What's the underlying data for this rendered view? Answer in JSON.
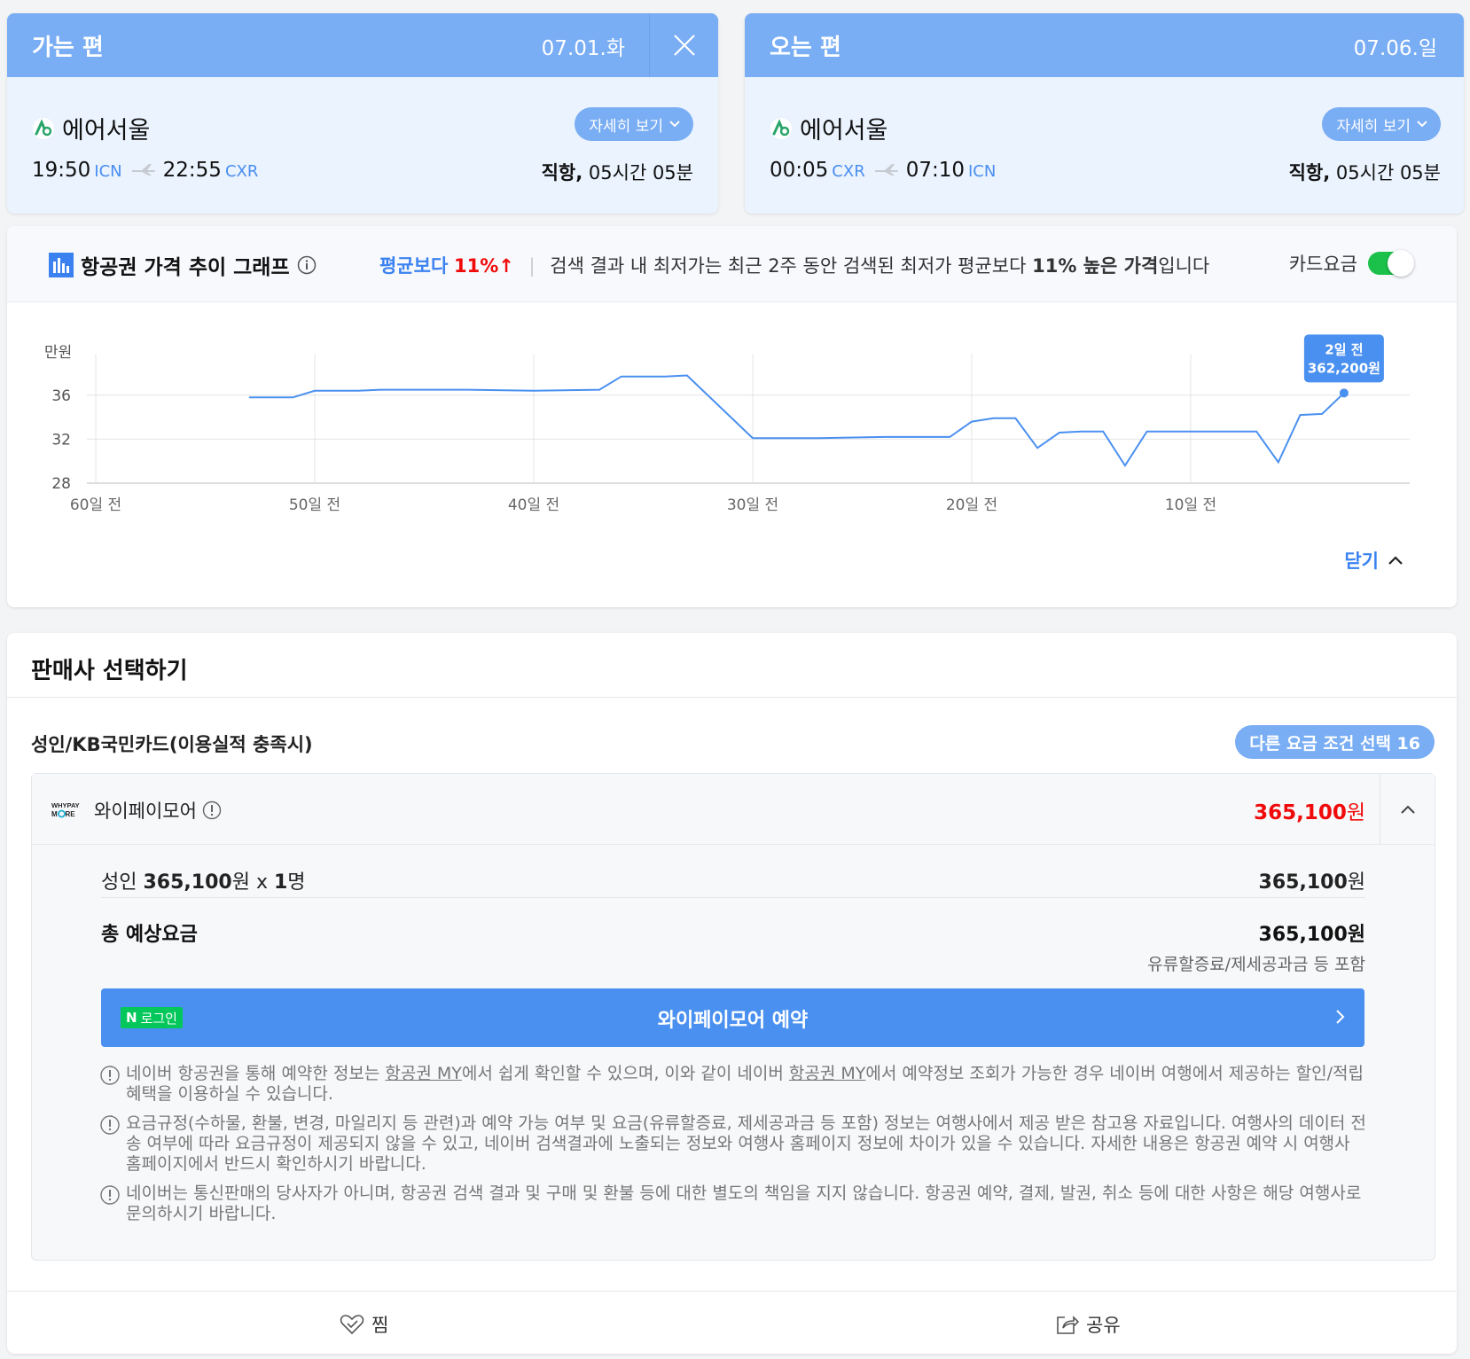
{
  "outbound": {
    "title": "가는 편",
    "date": "07.01.화",
    "airline": "에어서울",
    "detail_label": "자세히 보기",
    "depart_time": "19:50",
    "depart_code": "ICN",
    "arrive_time": "22:55",
    "arrive_code": "CXR",
    "duration_type": "직항,",
    "duration": "05시간 05분"
  },
  "inbound": {
    "title": "오는 편",
    "date": "07.06.일",
    "airline": "에어서울",
    "detail_label": "자세히 보기",
    "depart_time": "00:05",
    "depart_code": "CXR",
    "arrive_time": "07:10",
    "arrive_code": "ICN",
    "duration_type": "직항,",
    "duration": "05시간 05분"
  },
  "graph": {
    "title": "항공권 가격 추이 그래프",
    "avg_label": "평균보다",
    "avg_pct": "11%",
    "avg_arrow": "↑",
    "desc_prefix": "검색 결과 내 최저가는 최근 2주 동안 검색된 최저가 평균보다 ",
    "desc_bold": "11% 높은 가격",
    "desc_suffix": "입니다",
    "card_fee_label": "카드요금",
    "card_fee_on": true,
    "close_label": "닫기"
  },
  "chart_data": {
    "type": "line",
    "ylabel": "만원",
    "ylim": [
      28,
      38
    ],
    "yticks": [
      28,
      32,
      36
    ],
    "xlim": [
      60,
      0
    ],
    "xticks": [
      {
        "value": 60,
        "label": "60일 전"
      },
      {
        "value": 50,
        "label": "50일 전"
      },
      {
        "value": 40,
        "label": "40일 전"
      },
      {
        "value": 30,
        "label": "30일 전"
      },
      {
        "value": 20,
        "label": "20일 전"
      },
      {
        "value": 10,
        "label": "10일 전"
      }
    ],
    "grid": true,
    "color": "#4a90f0",
    "series": [
      {
        "points": [
          [
            53,
            35.8
          ],
          [
            51,
            35.8
          ],
          [
            50,
            36.4
          ],
          [
            48,
            36.4
          ],
          [
            47,
            36.5
          ],
          [
            43,
            36.5
          ],
          [
            40,
            36.4
          ],
          [
            37,
            36.5
          ],
          [
            36,
            37.7
          ],
          [
            34,
            37.7
          ],
          [
            33,
            37.8
          ],
          [
            30,
            32.1
          ],
          [
            27,
            32.1
          ],
          [
            24,
            32.2
          ],
          [
            21,
            32.2
          ],
          [
            20,
            33.6
          ],
          [
            19,
            33.9
          ],
          [
            18,
            33.9
          ],
          [
            17,
            31.2
          ],
          [
            16,
            32.6
          ],
          [
            15,
            32.7
          ],
          [
            14,
            32.7
          ],
          [
            13,
            29.6
          ],
          [
            12,
            32.7
          ],
          [
            10,
            32.7
          ],
          [
            8,
            32.7
          ],
          [
            7,
            32.7
          ],
          [
            6,
            29.9
          ],
          [
            5,
            34.2
          ],
          [
            4,
            34.3
          ],
          [
            3,
            36.2
          ]
        ]
      }
    ],
    "tooltip": {
      "line1": "2일 전",
      "line2": "362,200원"
    }
  },
  "seller": {
    "title": "판매사 선택하기",
    "condition_label": "성인/KB국민카드(이용실적 충족시)",
    "other_condition_btn": "다른 요금 조건 선택 16",
    "vendor_logo_text": "WHYPAY MORE",
    "vendor_name": "와이페이모어",
    "vendor_price": "365,100",
    "won": "원",
    "adult_label": "성인",
    "adult_price": "365,100",
    "adult_mult": "x",
    "adult_count": "1",
    "adult_unit": "명",
    "row_price": "365,100",
    "total_label": "총 예상요금",
    "total_price": "365,100",
    "total_note": "유류할증료/제세공과금 등 포함",
    "nlogin_n": "N",
    "nlogin_label": "로그인",
    "book_label": "와이페이모어 예약",
    "notice1_a": "네이버 항공권을 통해 예약한 정보는 ",
    "notice1_link1": "항공권 MY",
    "notice1_b": "에서 쉽게 확인할 수 있으며, 이와 같이 네이버 ",
    "notice1_link2": "항공권 MY",
    "notice1_c": "에서 예약정보 조회가 가능한 경우 네이버 여행에서 제공하는 할인/적립 혜택을 이용하실 수 있습니다.",
    "notice2": "요금규정(수하물, 환불, 변경, 마일리지 등 관련)과 예약 가능 여부 및 요금(유류할증료, 제세공과금 등 포함) 정보는 여행사에서 제공 받은 참고용 자료입니다. 여행사의 데이터 전송 여부에 따라 요금규정이 제공되지 않을 수 있고, 네이버 검색결과에 노출되는 정보와 여행사 홈페이지 정보에 차이가 있을 수 있습니다. 자세한 내용은 항공권 예약 시 여행사 홈페이지에서 반드시 확인하시기 바랍니다.",
    "notice3": "네이버는 통신판매의 당사자가 아니며, 항공권 검색 결과 및 구매 및 환불 등에 대한 별도의 책임을 지지 않습니다. 항공권 예약, 결제, 발권, 취소 등에 대한 사항은 해당 여행사로 문의하시기 바랍니다.",
    "like_label": "찜",
    "share_label": "공유"
  },
  "colors": {
    "header_blue": "#79adf4",
    "accent_blue": "#3b82f0",
    "price_red": "#f00a0a",
    "naver_green": "#03c75a"
  },
  "icons": [
    "close-icon",
    "airline-logo",
    "chevron-down-icon",
    "plane-icon",
    "bar-chart-icon",
    "info-icon",
    "chevron-up-icon",
    "heart-icon",
    "share-icon",
    "chevron-right-icon"
  ]
}
